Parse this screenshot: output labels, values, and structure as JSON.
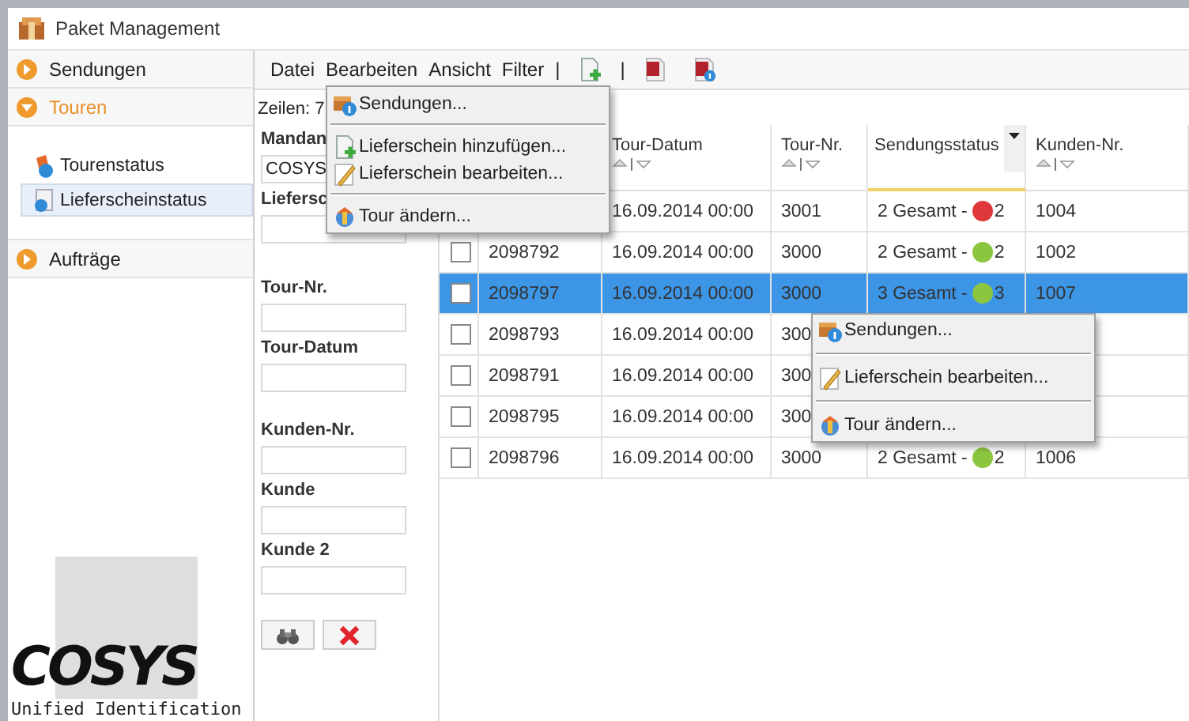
{
  "window": {
    "title": "Paket Management"
  },
  "sidebar": {
    "items": [
      {
        "label": "Sendungen",
        "expanded": false
      },
      {
        "label": "Touren",
        "expanded": true,
        "children": [
          {
            "label": "Tourenstatus",
            "selected": false
          },
          {
            "label": "Lieferscheinstatus",
            "selected": true
          }
        ]
      },
      {
        "label": "Aufträge",
        "expanded": false
      }
    ]
  },
  "logo": {
    "text": "COSYS",
    "tagline": "Unified Identification"
  },
  "menubar": {
    "items": [
      "Datei",
      "Bearbeiten",
      "Ansicht",
      "Filter"
    ],
    "toolbar": [
      {
        "kind": "separator",
        "text": "|"
      },
      {
        "kind": "add-doc"
      },
      {
        "kind": "separator",
        "text": "|"
      },
      {
        "kind": "red-doc"
      },
      {
        "kind": "info-doc"
      }
    ]
  },
  "row_count": "Zeilen: 7",
  "filter_panel": {
    "fields": [
      {
        "label": "Mandan",
        "value": "COSYS"
      },
      {
        "label": "Liefersc"
      },
      {
        "label": "Tour-Nr."
      },
      {
        "label": "Tour-Datum"
      },
      {
        "label": "Kunden-Nr."
      },
      {
        "label": "Kunde"
      },
      {
        "label": "Kunde 2"
      }
    ],
    "buttons": [
      {
        "kind": "search"
      },
      {
        "kind": "clear"
      }
    ]
  },
  "table": {
    "columns": [
      {
        "label": "Tour-Datum",
        "sortable": true,
        "active": false
      },
      {
        "label": "Tour-Nr.",
        "sortable": true,
        "active": false
      },
      {
        "label": "Sendungsstatus",
        "sortable": false,
        "active": true
      },
      {
        "label": "Kunden-Nr.",
        "sortable": true,
        "active": false
      }
    ],
    "rows": [
      {
        "selected": false,
        "date": "16.09.2014 00:00",
        "tour": "3001",
        "status": {
          "text": "2 Gesamt -",
          "count": "2",
          "color": "#e0383a"
        },
        "customer": "1004"
      },
      {
        "checked": false,
        "selected": false,
        "number": "2098792",
        "date": "16.09.2014 00:00",
        "tour": "3000",
        "status": {
          "text": "2 Gesamt -",
          "count": "2",
          "color": "#8cc63e"
        },
        "customer": "1002"
      },
      {
        "checked": false,
        "selected": true,
        "number": "2098797",
        "date": "16.09.2014 00:00",
        "tour": "3000",
        "status": {
          "text": "3 Gesamt -",
          "count": "3",
          "color": "#8cc63e"
        },
        "customer": "1007"
      },
      {
        "checked": false,
        "selected": false,
        "number": "2098793",
        "date": "16.09.2014 00:00",
        "tour": "300"
      },
      {
        "checked": false,
        "selected": false,
        "number": "2098791",
        "date": "16.09.2014 00:00",
        "tour": "300"
      },
      {
        "checked": false,
        "selected": false,
        "number": "2098795",
        "date": "16.09.2014 00:00",
        "tour": "300"
      },
      {
        "checked": false,
        "selected": false,
        "number": "2098796",
        "date": "16.09.2014 00:00",
        "tour": "3000",
        "status": {
          "text": "2 Gesamt -",
          "count": "2",
          "color": "#8cc63e"
        },
        "customer": "1006"
      }
    ]
  },
  "dropdown_menu": {
    "items": [
      {
        "kind": "shipments",
        "label": "Sendungen..."
      },
      {
        "kind": "separator"
      },
      {
        "kind": "add-doc",
        "label": "Lieferschein hinzufügen..."
      },
      {
        "kind": "edit-doc",
        "label": "Lieferschein bearbeiten..."
      },
      {
        "kind": "separator"
      },
      {
        "kind": "tour",
        "label": "Tour ändern..."
      }
    ]
  },
  "context_menu": {
    "items": [
      {
        "kind": "shipments",
        "label": "Sendungen..."
      },
      {
        "kind": "separator"
      },
      {
        "kind": "edit-doc",
        "label": "Lieferschein bearbeiten..."
      },
      {
        "kind": "separator"
      },
      {
        "kind": "tour",
        "label": "Tour ändern..."
      }
    ]
  }
}
